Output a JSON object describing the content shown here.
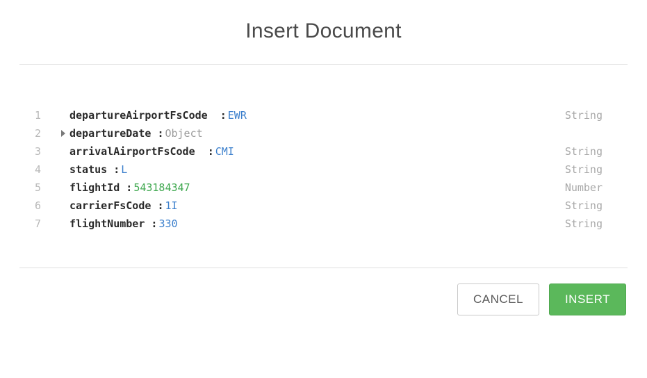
{
  "dialog": {
    "title": "Insert Document"
  },
  "fields": [
    {
      "line": "1",
      "key": "departureAirportFsCode",
      "keypad": "  ",
      "value": "EWR",
      "type": "String",
      "valueClass": "val-string",
      "expandable": false
    },
    {
      "line": "2",
      "key": "departureDate",
      "keypad": " ",
      "value": "Object",
      "type": "",
      "valueClass": "val-object",
      "expandable": true
    },
    {
      "line": "3",
      "key": "arrivalAirportFsCode",
      "keypad": "  ",
      "value": "CMI",
      "type": "String",
      "valueClass": "val-string",
      "expandable": false
    },
    {
      "line": "4",
      "key": "status",
      "keypad": " ",
      "value": "L",
      "type": "String",
      "valueClass": "val-string",
      "expandable": false
    },
    {
      "line": "5",
      "key": "flightId",
      "keypad": " ",
      "value": "543184347",
      "type": "Number",
      "valueClass": "val-number",
      "expandable": false
    },
    {
      "line": "6",
      "key": "carrierFsCode",
      "keypad": " ",
      "value": "1I",
      "type": "String",
      "valueClass": "val-string",
      "expandable": false
    },
    {
      "line": "7",
      "key": "flightNumber",
      "keypad": " ",
      "value": "330",
      "type": "String",
      "valueClass": "val-string",
      "expandable": false
    }
  ],
  "buttons": {
    "cancel": "CANCEL",
    "insert": "INSERT"
  }
}
